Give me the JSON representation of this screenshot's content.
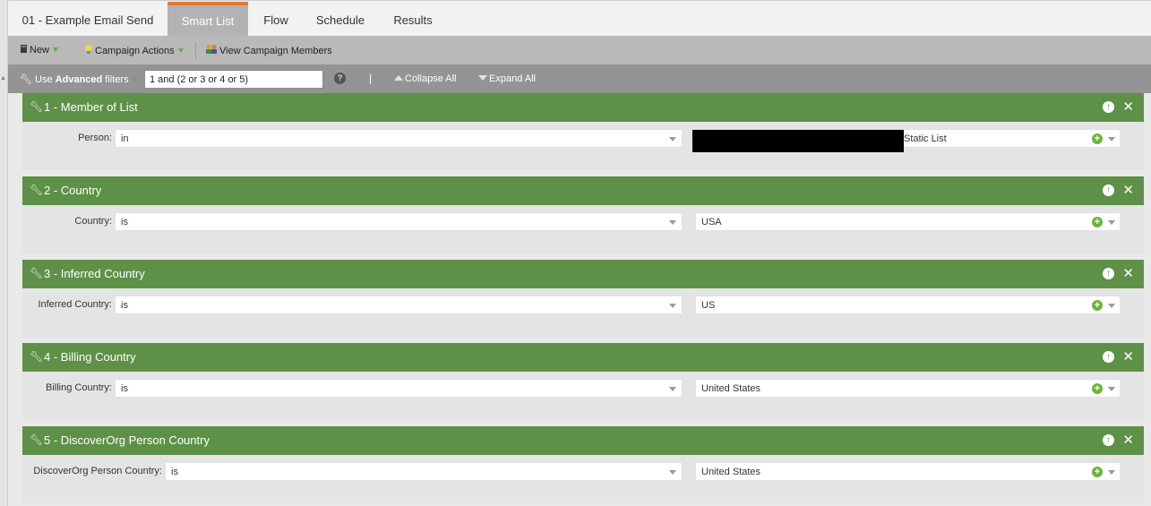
{
  "tabs": [
    {
      "label": "01 - Example Email Send",
      "active": false
    },
    {
      "label": "Smart List",
      "active": true
    },
    {
      "label": "Flow",
      "active": false
    },
    {
      "label": "Schedule",
      "active": false
    },
    {
      "label": "Results",
      "active": false
    }
  ],
  "toolbar": {
    "new_label": "New",
    "campaign_actions_label": "Campaign Actions",
    "view_members_label": "View Campaign Members"
  },
  "filterbar": {
    "use_label": "Use",
    "advanced_label": "Advanced",
    "filters_label": "filters",
    "logic_value": "1 and (2 or 3 or 4 or 5)",
    "help_glyph": "?",
    "separator": "|",
    "collapse_label": "Collapse All",
    "expand_label": "Expand All"
  },
  "filters": [
    {
      "title": "1 - Member of List",
      "field_label": "Person:",
      "operator": "in",
      "value": "Static List"
    },
    {
      "title": "2 - Country",
      "field_label": "Country:",
      "operator": "is",
      "value": "USA"
    },
    {
      "title": "3 - Inferred Country",
      "field_label": "Inferred Country:",
      "operator": "is",
      "value": "US"
    },
    {
      "title": "4 - Billing Country",
      "field_label": "Billing Country:",
      "operator": "is",
      "value": "United States"
    },
    {
      "title": "5 - DiscoverOrg Person Country",
      "field_label": "DiscoverOrg Person Country:",
      "operator": "is",
      "value": "United States"
    }
  ],
  "colors": {
    "header_green": "#5e9147",
    "tab_accent": "#e07a32",
    "plus_green": "#6db33f"
  }
}
